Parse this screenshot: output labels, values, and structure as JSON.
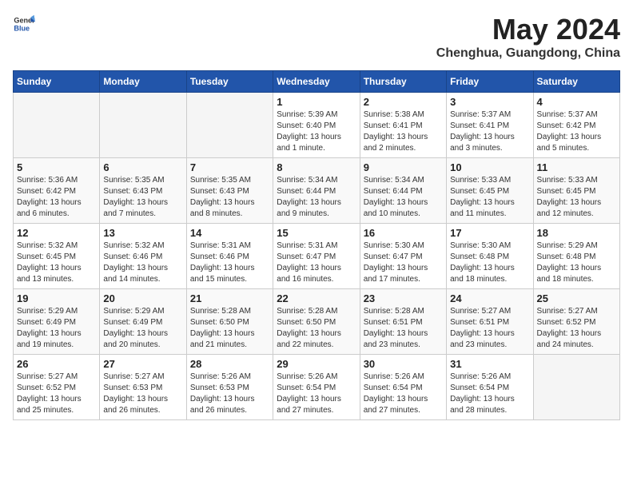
{
  "logo": {
    "text_general": "General",
    "text_blue": "Blue"
  },
  "title": "May 2024",
  "subtitle": "Chenghua, Guangdong, China",
  "days_of_week": [
    "Sunday",
    "Monday",
    "Tuesday",
    "Wednesday",
    "Thursday",
    "Friday",
    "Saturday"
  ],
  "weeks": [
    [
      {
        "date": "",
        "info": ""
      },
      {
        "date": "",
        "info": ""
      },
      {
        "date": "",
        "info": ""
      },
      {
        "date": "1",
        "info": "Sunrise: 5:39 AM\nSunset: 6:40 PM\nDaylight: 13 hours\nand 1 minute."
      },
      {
        "date": "2",
        "info": "Sunrise: 5:38 AM\nSunset: 6:41 PM\nDaylight: 13 hours\nand 2 minutes."
      },
      {
        "date": "3",
        "info": "Sunrise: 5:37 AM\nSunset: 6:41 PM\nDaylight: 13 hours\nand 3 minutes."
      },
      {
        "date": "4",
        "info": "Sunrise: 5:37 AM\nSunset: 6:42 PM\nDaylight: 13 hours\nand 5 minutes."
      }
    ],
    [
      {
        "date": "5",
        "info": "Sunrise: 5:36 AM\nSunset: 6:42 PM\nDaylight: 13 hours\nand 6 minutes."
      },
      {
        "date": "6",
        "info": "Sunrise: 5:35 AM\nSunset: 6:43 PM\nDaylight: 13 hours\nand 7 minutes."
      },
      {
        "date": "7",
        "info": "Sunrise: 5:35 AM\nSunset: 6:43 PM\nDaylight: 13 hours\nand 8 minutes."
      },
      {
        "date": "8",
        "info": "Sunrise: 5:34 AM\nSunset: 6:44 PM\nDaylight: 13 hours\nand 9 minutes."
      },
      {
        "date": "9",
        "info": "Sunrise: 5:34 AM\nSunset: 6:44 PM\nDaylight: 13 hours\nand 10 minutes."
      },
      {
        "date": "10",
        "info": "Sunrise: 5:33 AM\nSunset: 6:45 PM\nDaylight: 13 hours\nand 11 minutes."
      },
      {
        "date": "11",
        "info": "Sunrise: 5:33 AM\nSunset: 6:45 PM\nDaylight: 13 hours\nand 12 minutes."
      }
    ],
    [
      {
        "date": "12",
        "info": "Sunrise: 5:32 AM\nSunset: 6:45 PM\nDaylight: 13 hours\nand 13 minutes."
      },
      {
        "date": "13",
        "info": "Sunrise: 5:32 AM\nSunset: 6:46 PM\nDaylight: 13 hours\nand 14 minutes."
      },
      {
        "date": "14",
        "info": "Sunrise: 5:31 AM\nSunset: 6:46 PM\nDaylight: 13 hours\nand 15 minutes."
      },
      {
        "date": "15",
        "info": "Sunrise: 5:31 AM\nSunset: 6:47 PM\nDaylight: 13 hours\nand 16 minutes."
      },
      {
        "date": "16",
        "info": "Sunrise: 5:30 AM\nSunset: 6:47 PM\nDaylight: 13 hours\nand 17 minutes."
      },
      {
        "date": "17",
        "info": "Sunrise: 5:30 AM\nSunset: 6:48 PM\nDaylight: 13 hours\nand 18 minutes."
      },
      {
        "date": "18",
        "info": "Sunrise: 5:29 AM\nSunset: 6:48 PM\nDaylight: 13 hours\nand 18 minutes."
      }
    ],
    [
      {
        "date": "19",
        "info": "Sunrise: 5:29 AM\nSunset: 6:49 PM\nDaylight: 13 hours\nand 19 minutes."
      },
      {
        "date": "20",
        "info": "Sunrise: 5:29 AM\nSunset: 6:49 PM\nDaylight: 13 hours\nand 20 minutes."
      },
      {
        "date": "21",
        "info": "Sunrise: 5:28 AM\nSunset: 6:50 PM\nDaylight: 13 hours\nand 21 minutes."
      },
      {
        "date": "22",
        "info": "Sunrise: 5:28 AM\nSunset: 6:50 PM\nDaylight: 13 hours\nand 22 minutes."
      },
      {
        "date": "23",
        "info": "Sunrise: 5:28 AM\nSunset: 6:51 PM\nDaylight: 13 hours\nand 23 minutes."
      },
      {
        "date": "24",
        "info": "Sunrise: 5:27 AM\nSunset: 6:51 PM\nDaylight: 13 hours\nand 23 minutes."
      },
      {
        "date": "25",
        "info": "Sunrise: 5:27 AM\nSunset: 6:52 PM\nDaylight: 13 hours\nand 24 minutes."
      }
    ],
    [
      {
        "date": "26",
        "info": "Sunrise: 5:27 AM\nSunset: 6:52 PM\nDaylight: 13 hours\nand 25 minutes."
      },
      {
        "date": "27",
        "info": "Sunrise: 5:27 AM\nSunset: 6:53 PM\nDaylight: 13 hours\nand 26 minutes."
      },
      {
        "date": "28",
        "info": "Sunrise: 5:26 AM\nSunset: 6:53 PM\nDaylight: 13 hours\nand 26 minutes."
      },
      {
        "date": "29",
        "info": "Sunrise: 5:26 AM\nSunset: 6:54 PM\nDaylight: 13 hours\nand 27 minutes."
      },
      {
        "date": "30",
        "info": "Sunrise: 5:26 AM\nSunset: 6:54 PM\nDaylight: 13 hours\nand 27 minutes."
      },
      {
        "date": "31",
        "info": "Sunrise: 5:26 AM\nSunset: 6:54 PM\nDaylight: 13 hours\nand 28 minutes."
      },
      {
        "date": "",
        "info": ""
      }
    ]
  ]
}
